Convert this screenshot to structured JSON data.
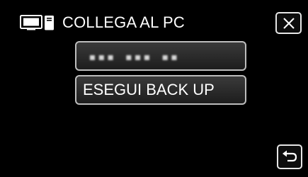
{
  "header": {
    "icon": "pc-connection-icon",
    "title": "COLLEGA AL PC",
    "close_icon": "close-icon"
  },
  "options": [
    {
      "label": "▪▪▪ ▪▪▪ ▪▪",
      "state": "obscured"
    },
    {
      "label": "ESEGUI BACK UP"
    }
  ],
  "footer": {
    "back_icon": "return-arrow-icon"
  },
  "colors": {
    "background": "#000000",
    "button_border": "#bdbdbd",
    "text": "#ffffff"
  }
}
